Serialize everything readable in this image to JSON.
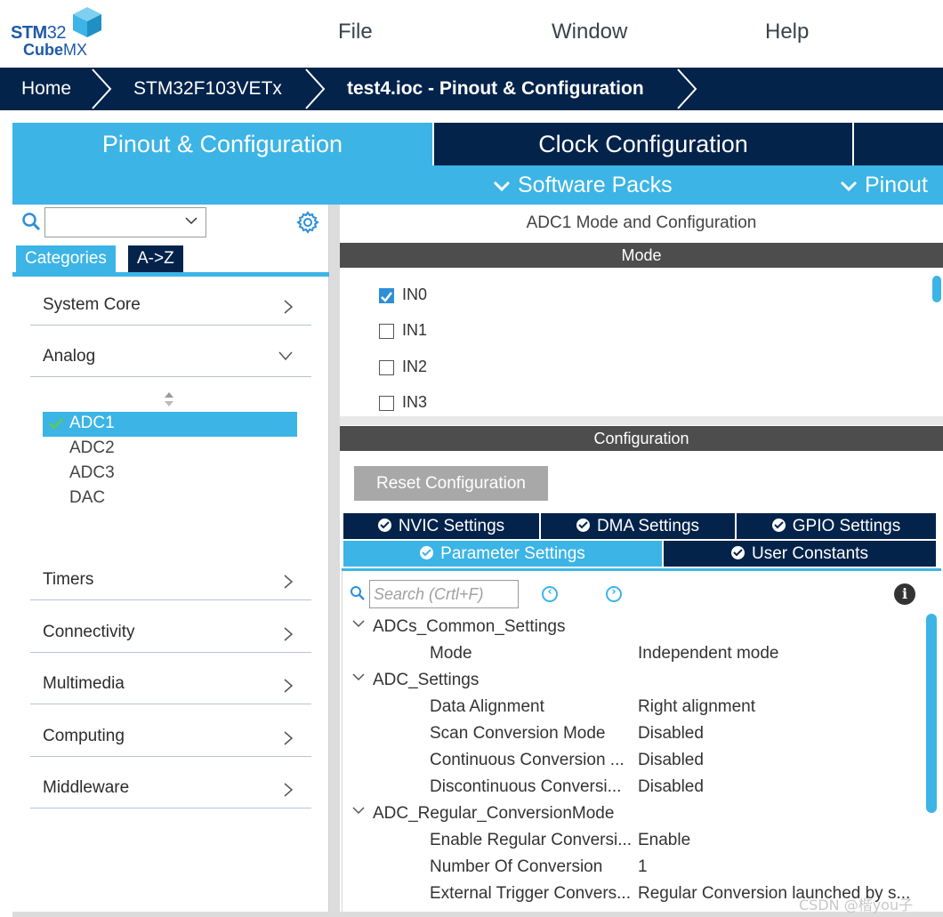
{
  "logo": {
    "line1_a": "STM",
    "line1_b": "32",
    "line2_a": "Cube",
    "line2_b": "MX"
  },
  "menu": {
    "file": "File",
    "window": "Window",
    "help": "Help"
  },
  "breadcrumb": {
    "home": "Home",
    "device": "STM32F103VETx",
    "project": "test4.ioc - Pinout & Configuration"
  },
  "tabs": {
    "pinout": "Pinout & Configuration",
    "clock": "Clock Configuration"
  },
  "subbar": {
    "software_packs": "Software Packs",
    "pinout": "Pinout"
  },
  "left": {
    "tab_categories": "Categories",
    "tab_az": "A->Z",
    "categories": {
      "system_core": "System Core",
      "analog": "Analog",
      "timers": "Timers",
      "connectivity": "Connectivity",
      "multimedia": "Multimedia",
      "computing": "Computing",
      "middleware": "Middleware"
    },
    "analog_items": [
      "ADC1",
      "ADC2",
      "ADC3",
      "DAC"
    ]
  },
  "right": {
    "title": "ADC1 Mode and Configuration",
    "mode_header": "Mode",
    "mode_items": [
      {
        "label": "IN0",
        "checked": true
      },
      {
        "label": "IN1",
        "checked": false
      },
      {
        "label": "IN2",
        "checked": false
      },
      {
        "label": "IN3",
        "checked": false
      }
    ],
    "config_header": "Configuration",
    "reset_button": "Reset Configuration",
    "config_tabs": {
      "nvic": "NVIC Settings",
      "dma": "DMA Settings",
      "gpio": "GPIO Settings",
      "parameter": "Parameter Settings",
      "user_constants": "User Constants"
    },
    "search_placeholder": "Search (Crtl+F)",
    "tree": {
      "common_group": "ADCs_Common_Settings",
      "mode_key": "Mode",
      "mode_val": "Independent mode",
      "adc_group": "ADC_Settings",
      "align_key": "Data Alignment",
      "align_val": "Right alignment",
      "scan_key": "Scan Conversion Mode",
      "scan_val": "Disabled",
      "cont_key": "Continuous Conversion ...",
      "cont_val": "Disabled",
      "disc_key": "Discontinuous Conversi...",
      "disc_val": "Disabled",
      "regular_group": "ADC_Regular_ConversionMode",
      "enable_key": "Enable Regular Conversi...",
      "enable_val": "Enable",
      "num_key": "Number Of Conversion",
      "num_val": "1",
      "ext_key": "External Trigger Convers...",
      "ext_val": "Regular Conversion launched by s..."
    }
  },
  "watermark": "CSDN @楷you子",
  "colors": {
    "navy": "#03234b",
    "accent": "#3cb4e6",
    "dark_bar": "#4d4d4d"
  }
}
